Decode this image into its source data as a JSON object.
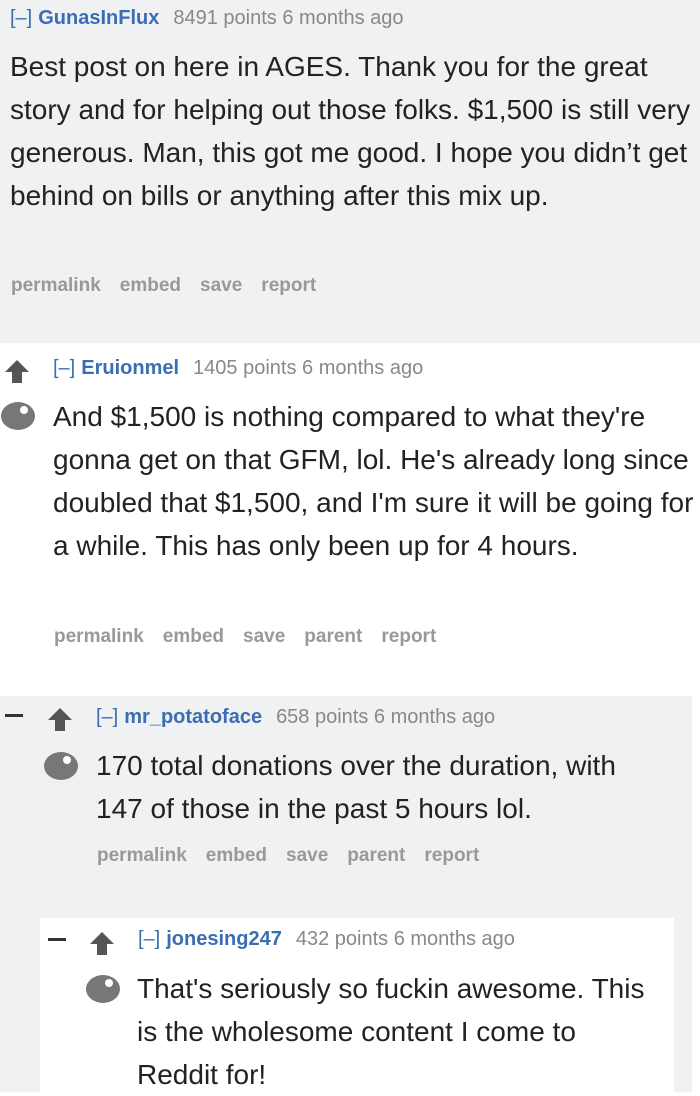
{
  "comments": [
    {
      "collapse": "[–]",
      "user": "GunasInFlux",
      "score": "8491 points",
      "time": "6 months ago",
      "body": "Best post on here in AGES. Thank you for the great story and for helping out those folks. $1,500 is still very generous. Man, this got me good. I hope you didn’t get behind on bills or anything after this mix up.",
      "actions": [
        "permalink",
        "embed",
        "save",
        "report"
      ]
    },
    {
      "collapse": "[–]",
      "user": "Eruionmel",
      "score": "1405 points",
      "time": "6 months ago",
      "body": "And $1,500 is nothing compared to what they're gonna get on that GFM, lol. He's already long since doubled that $1,500, and I'm sure it will be going for a while. This has only been up for 4 hours.",
      "actions": [
        "permalink",
        "embed",
        "save",
        "parent",
        "report"
      ]
    },
    {
      "collapse": "[–]",
      "user": "mr_potatoface",
      "score": "658 points",
      "time": "6 months ago",
      "body": "170 total donations over the duration, with 147 of those in the past 5 hours lol.",
      "actions": [
        "permalink",
        "embed",
        "save",
        "parent",
        "report"
      ]
    },
    {
      "collapse": "[–]",
      "user": "jonesing247",
      "score": "432 points",
      "time": "6 months ago",
      "body": "That's seriously so fuckin awesome. This is the wholesome content I come to Reddit for!",
      "actions": []
    }
  ],
  "colors": {
    "link": "#3a6db4",
    "muted": "#999999",
    "gray_bg": "#eff1f3"
  },
  "icons": [
    "upvote-arrow-icon",
    "snoo-alien-icon",
    "collapse-dash-icon"
  ]
}
